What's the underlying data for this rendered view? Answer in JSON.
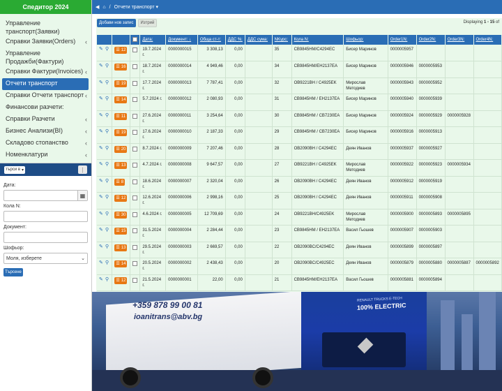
{
  "app": {
    "title": "Спедитор 2024"
  },
  "menu": [
    {
      "label": "Управление транспорт(Заявки)",
      "chevron": false,
      "active": false
    },
    {
      "label": "Справки Заявки(Orders)",
      "chevron": true,
      "active": false
    },
    {
      "label": "Управление Продажби(Фактури)",
      "chevron": false,
      "active": false
    },
    {
      "label": "Справки Фактури(Invoices)",
      "chevron": true,
      "active": false
    },
    {
      "label": "Отчети транспорт",
      "chevron": false,
      "active": true
    },
    {
      "label": "Справки Отчети транспорт",
      "chevron": true,
      "active": false
    },
    {
      "label": "Финансови разчети:",
      "chevron": false,
      "active": false
    },
    {
      "label": "Справки Разчети",
      "chevron": true,
      "active": false
    },
    {
      "label": "Бизнес Анализи(BI)",
      "chevron": true,
      "active": false
    },
    {
      "label": "Складово стопанство",
      "chevron": true,
      "active": false
    },
    {
      "label": "Номенклатури",
      "chevron": true,
      "active": false
    }
  ],
  "filter_bar": {
    "select_label": "търси в",
    "more": "⋮"
  },
  "filters": {
    "date_label": "Дата:",
    "car_label": "Кола N:",
    "doc_label": "Документ:",
    "driver_label": "Шофьор:",
    "driver_value": "Моля, изберете",
    "search_button": "Търсене"
  },
  "topbar": {
    "breadcrumb": "Отчети транспорт"
  },
  "toolbar": {
    "add_label": "Добави нов запис",
    "delete_label": "Изтрий",
    "displaying_prefix": "Displaying",
    "displaying_range": "1 - 15",
    "displaying_suffix": "of"
  },
  "columns": [
    "Дата:",
    "Документ:",
    "Обща ст-т:",
    "ДДС %:",
    "ДДС сума:",
    "NKурс:",
    "Кола N:",
    "Шофьор:",
    "Order1N:",
    "Order2N:",
    "Order3N:",
    "Order4N:"
  ],
  "rows": [
    {
      "count": "12",
      "date": "19.7.2024 г.",
      "doc": "0000000015",
      "sum": "3 308,13",
      "vat": "0,00",
      "nk": "35",
      "car": "CB9845HM/C4294EC",
      "driver": "Бисер Маринов",
      "o1": "0000005957",
      "o2": "",
      "o3": "",
      "o4": ""
    },
    {
      "count": "16",
      "date": "18.7.2024 г.",
      "doc": "0000000014",
      "sum": "4 949,46",
      "vat": "0,00",
      "nk": "34",
      "car": "CB9845HM/EH2137EA",
      "driver": "Бисер Маринов",
      "o1": "0000005946",
      "o2": "0000005953",
      "o3": "",
      "o4": ""
    },
    {
      "count": "19",
      "date": "17.7.2024 г.",
      "doc": "0000000013",
      "sum": "7 787,41",
      "vat": "0,00",
      "nk": "32",
      "car": "OB9221BH / C4925EK",
      "driver": "Мирослав Методиев",
      "o1": "0000005943",
      "o2": "0000005952",
      "o3": "",
      "o4": ""
    },
    {
      "count": "14",
      "date": "5.7.2024 г.",
      "doc": "0000000012",
      "sum": "2 080,93",
      "vat": "0,00",
      "nk": "31",
      "car": "CB9845HM / EH2137EA",
      "driver": "Бисер Маринов",
      "o1": "0000005940",
      "o2": "0000005939",
      "o3": "",
      "o4": ""
    },
    {
      "count": "11",
      "date": "27.6.2024 г.",
      "doc": "0000000011",
      "sum": "3 254,64",
      "vat": "0,00",
      "nk": "30",
      "car": "CB9845HM / CB7230EA",
      "driver": "Бисер Маринов",
      "o1": "0000005924",
      "o2": "0000005929",
      "o3": "0000005928",
      "o4": ""
    },
    {
      "count": "19",
      "date": "17.6.2024 г.",
      "doc": "0000000010",
      "sum": "2 187,33",
      "vat": "0,00",
      "nk": "29",
      "car": "CB9845HM / CB7230EA",
      "driver": "Бисер Маринов",
      "o1": "0000005916",
      "o2": "0000005913",
      "o3": "",
      "o4": ""
    },
    {
      "count": "20",
      "date": "8.7.2024 г.",
      "doc": "0000000009",
      "sum": "7 207,46",
      "vat": "0,00",
      "nk": "28",
      "car": "OB2090BH / C4294EC",
      "driver": "Деян Иванов",
      "o1": "0000005937",
      "o2": "0000005927",
      "o3": "",
      "o4": ""
    },
    {
      "count": "13",
      "date": "4.7.2024 г.",
      "doc": "0000000008",
      "sum": "9 647,57",
      "vat": "0,00",
      "nk": "27",
      "car": "OB9221BH / C4925EK",
      "driver": "Мирослав Методиев",
      "o1": "0000005922",
      "o2": "0000005923",
      "o3": "0000005934",
      "o4": ""
    },
    {
      "count": "8",
      "date": "18.6.2024 г.",
      "doc": "0000000007",
      "sum": "2 320,04",
      "vat": "0,00",
      "nk": "26",
      "car": "OB2090BH / C4294EC",
      "driver": "Деян Иванов",
      "o1": "0000005912",
      "o2": "0000005919",
      "o3": "",
      "o4": ""
    },
    {
      "count": "12",
      "date": "12.6.2024 г.",
      "doc": "0000000006",
      "sum": "2 998,16",
      "vat": "0,00",
      "nk": "25",
      "car": "OB2090BH / C4294EC",
      "driver": "Деян Иванов",
      "o1": "0000005911",
      "o2": "0000005908",
      "o3": "",
      "o4": ""
    },
    {
      "count": "30",
      "date": "4.6.2024 г.",
      "doc": "0000000005",
      "sum": "12 709,69",
      "vat": "0,00",
      "nk": "24",
      "car": "OB9221BH/C4925EK",
      "driver": "Мирослав Методиев",
      "o1": "0000005900",
      "o2": "0000005893",
      "o3": "0000005895",
      "o4": ""
    },
    {
      "count": "15",
      "date": "31.5.2024 г.",
      "doc": "0000000004",
      "sum": "2 284,44",
      "vat": "0,00",
      "nk": "23",
      "car": "CB9845HM / EH2137EA",
      "driver": "Васил Гьошев",
      "o1": "0000005907",
      "o2": "0000005903",
      "o3": "",
      "o4": ""
    },
    {
      "count": "13",
      "date": "29.5.2024 г.",
      "doc": "0000000003",
      "sum": "2 669,57",
      "vat": "0,00",
      "nk": "22",
      "car": "OB2090BC/C4294EC",
      "driver": "Деян Иванов",
      "o1": "0000005899",
      "o2": "0000005897",
      "o3": "",
      "o4": ""
    },
    {
      "count": "14",
      "date": "20.5.2024 г.",
      "doc": "0000000002",
      "sum": "2 438,43",
      "vat": "0,00",
      "nk": "20",
      "car": "OB2090BC/C4925EC",
      "driver": "Деян Иванов",
      "o1": "0000005879",
      "o2": "0000005880",
      "o3": "0000005887",
      "o4": "0000005892"
    },
    {
      "count": "12",
      "date": "21.5.2024 г.",
      "doc": "0000000001",
      "sum": "22,00",
      "vat": "0,00",
      "nk": "21",
      "car": "CB9845HM/EH2137EA",
      "driver": "Васил Гьошев",
      "o1": "0000005881",
      "o2": "0000005894",
      "o3": "",
      "o4": ""
    }
  ],
  "background": {
    "phone": "+359 878 99 00 81",
    "email": "ioanitrans@abv.bg",
    "brand": "100% ELECTRIC",
    "brand_small": "RENAULT TRUCKS E-TECH"
  },
  "colors": {
    "accent": "#2a6db5",
    "brand_green": "#2aaa33",
    "badge": "#e87814",
    "grid_bg": "#e9f8ea"
  }
}
